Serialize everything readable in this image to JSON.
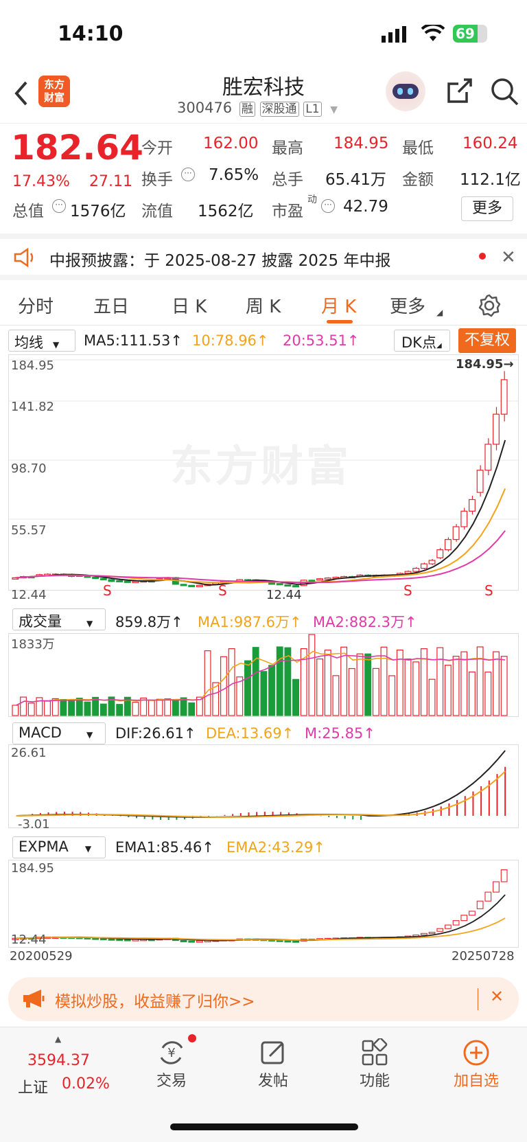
{
  "status_bar": {
    "time": "14:10",
    "battery": "69"
  },
  "header": {
    "logo_line1": "东方",
    "logo_line2": "财富",
    "stock_name": "胜宏科技",
    "stock_code": "300476",
    "tags": [
      "融",
      "深股通",
      "L1"
    ]
  },
  "quote": {
    "price": "182.64",
    "change_pct": "17.43%",
    "change_amt": "27.11",
    "rows": [
      [
        {
          "label": "今开",
          "value": "162.00"
        },
        {
          "label": "最高",
          "value": "184.95"
        },
        {
          "label": "最低",
          "value": "160.24"
        }
      ],
      [
        {
          "label": "换手",
          "value": "7.65%"
        },
        {
          "label": "总手",
          "value": "65.41万"
        },
        {
          "label": "金额",
          "value": "112.1亿"
        }
      ],
      [
        {
          "label": "总值",
          "value": "1576亿"
        },
        {
          "label": "流值",
          "value": "1562亿"
        },
        {
          "label": "市盈",
          "sup": "动",
          "value": "42.79"
        }
      ]
    ],
    "more_label": "更多"
  },
  "notice": {
    "text": "中报预披露：于 2025-08-27 披露 2025 年中报"
  },
  "tabs": [
    "分时",
    "五日",
    "日 K",
    "周 K",
    "月 K",
    "更多"
  ],
  "active_tab": "月 K",
  "main_chart": {
    "selector": "均线",
    "ma5": "MA5:111.53↑",
    "ma10": "10:78.96↑",
    "ma20": "20:53.51↑",
    "dk_label": "DK点",
    "fq_label": "不复权",
    "y_labels": [
      "184.95",
      "141.82",
      "98.70",
      "55.57",
      "12.44"
    ],
    "high_marker": "184.95→",
    "low_marker": "12.44",
    "watermark": "东方财富",
    "s_mark": "S"
  },
  "volume": {
    "selector": "成交量",
    "value": "859.8万↑",
    "ma1": "MA1:987.6万↑",
    "ma2": "MA2:882.3万↑",
    "y_label": "1833万"
  },
  "macd": {
    "selector": "MACD",
    "dif": "DIF:26.61↑",
    "dea": "DEA:13.69↑",
    "m": "M:25.85↑",
    "y_top": "26.61",
    "y_bottom": "-3.01"
  },
  "expma": {
    "selector": "EXPMA",
    "ema1": "EMA1:85.46↑",
    "ema2": "EMA2:43.29↑",
    "y_top": "184.95",
    "y_bottom": "12.44",
    "date_start": "20200529",
    "date_end": "20250728"
  },
  "banner": {
    "text": "模拟炒股，收益赚了归你>>"
  },
  "bottom_nav": {
    "index_value": "3594.37",
    "index_name": "上证",
    "index_pct": "0.02%",
    "items": [
      "交易",
      "发帖",
      "功能",
      "加自选"
    ]
  },
  "colors": {
    "up": "#e8232a",
    "down": "#1a9c3a",
    "accent": "#f06a1e",
    "ma10": "#f2a31a",
    "ma20": "#e03aa8"
  }
}
